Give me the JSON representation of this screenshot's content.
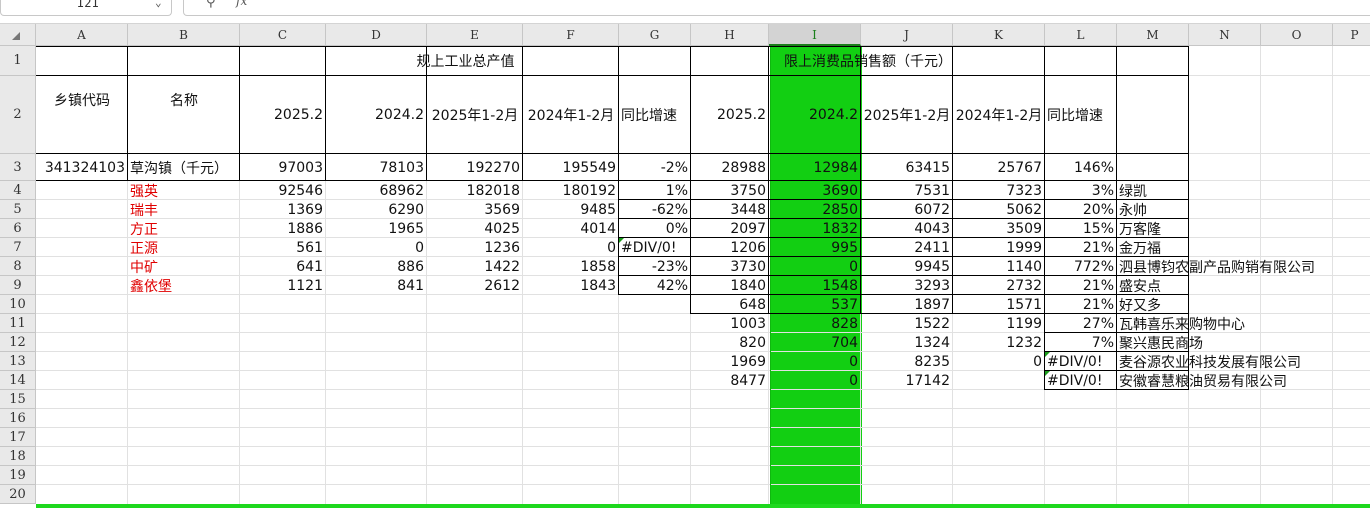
{
  "toolbar": {
    "name_box": "I21",
    "zoom_icon": "zoom-icon",
    "fx_label": "fx"
  },
  "columns": [
    "A",
    "B",
    "C",
    "D",
    "E",
    "F",
    "G",
    "H",
    "I",
    "J",
    "K",
    "L",
    "M",
    "N",
    "O",
    "P"
  ],
  "selected_column": "I",
  "rows": [
    "1",
    "2",
    "3",
    "4",
    "5",
    "6",
    "7",
    "8",
    "9",
    "10",
    "11",
    "12",
    "13",
    "14",
    "15",
    "16",
    "17",
    "18",
    "19",
    "20"
  ],
  "colors": {
    "highlight": "#12cf12",
    "red_text": "#e00000"
  },
  "header": {
    "town_code": "乡镇代码",
    "name": "名称",
    "industry_group": "规上工业总产值",
    "retail_group": "限上消费品销售额（千元）",
    "c": "2025.2",
    "d": "2024.2",
    "e": "2025年1-2月",
    "f": "2024年1-2月",
    "g": "同比增速",
    "h": "2025.2",
    "i": "2024.2",
    "j": "2025年1-2月",
    "k": "2024年1-2月",
    "l": "同比增速"
  },
  "total": {
    "a": "341324103",
    "b": "草沟镇（千元）",
    "c": "97003",
    "d": "78103",
    "e": "192270",
    "f": "195549",
    "g": "-2%",
    "h": "28988",
    "i": "12984",
    "j": "63415",
    "k": "25767",
    "l": "146%"
  },
  "data_rows": [
    {
      "b": "强英",
      "c": "92546",
      "d": "68962",
      "e": "182018",
      "f": "180192",
      "g": "1%",
      "h": "3750",
      "i": "3690",
      "j": "7531",
      "k": "7323",
      "l": "3%",
      "m": "绿凯"
    },
    {
      "b": "瑞丰",
      "c": "1369",
      "d": "6290",
      "e": "3569",
      "f": "9485",
      "g": "-62%",
      "h": "3448",
      "i": "2850",
      "j": "6072",
      "k": "5062",
      "l": "20%",
      "m": "永帅"
    },
    {
      "b": "方正",
      "c": "1886",
      "d": "1965",
      "e": "4025",
      "f": "4014",
      "g": "0%",
      "h": "2097",
      "i": "1832",
      "j": "4043",
      "k": "3509",
      "l": "15%",
      "m": "万客隆"
    },
    {
      "b": "正源",
      "c": "561",
      "d": "0",
      "e": "1236",
      "f": "0",
      "g": "#DIV/0!",
      "h": "1206",
      "i": "995",
      "j": "2411",
      "k": "1999",
      "l": "21%",
      "m": "金万福"
    },
    {
      "b": "中矿",
      "c": "641",
      "d": "886",
      "e": "1422",
      "f": "1858",
      "g": "-23%",
      "h": "3730",
      "i": "0",
      "j": "9945",
      "k": "1140",
      "l": "772%",
      "m": "泗县博钧农副产品购销有限公司"
    },
    {
      "b": "鑫依堡",
      "c": "1121",
      "d": "841",
      "e": "2612",
      "f": "1843",
      "g": "42%",
      "h": "1840",
      "i": "1548",
      "j": "3293",
      "k": "2732",
      "l": "21%",
      "m": "盛安点"
    },
    {
      "b": "",
      "c": "",
      "d": "",
      "e": "",
      "f": "",
      "g": "",
      "h": "648",
      "i": "537",
      "j": "1897",
      "k": "1571",
      "l": "21%",
      "m": "好又多"
    },
    {
      "b": "",
      "c": "",
      "d": "",
      "e": "",
      "f": "",
      "g": "",
      "h": "1003",
      "i": "828",
      "j": "1522",
      "k": "1199",
      "l": "27%",
      "m": "瓦韩喜乐来购物中心"
    },
    {
      "b": "",
      "c": "",
      "d": "",
      "e": "",
      "f": "",
      "g": "",
      "h": "820",
      "i": "704",
      "j": "1324",
      "k": "1232",
      "l": "7%",
      "m": "聚兴惠民商场"
    },
    {
      "b": "",
      "c": "",
      "d": "",
      "e": "",
      "f": "",
      "g": "",
      "h": "1969",
      "i": "0",
      "j": "8235",
      "k": "0",
      "l": "#DIV/0!",
      "m": "麦谷源农业科技发展有限公司"
    },
    {
      "b": "",
      "c": "",
      "d": "",
      "e": "",
      "f": "",
      "g": "",
      "h": "8477",
      "i": "0",
      "j": "17142",
      "k": "",
      "l": "#DIV/0!",
      "m": "安徽睿慧粮油贸易有限公司"
    }
  ]
}
